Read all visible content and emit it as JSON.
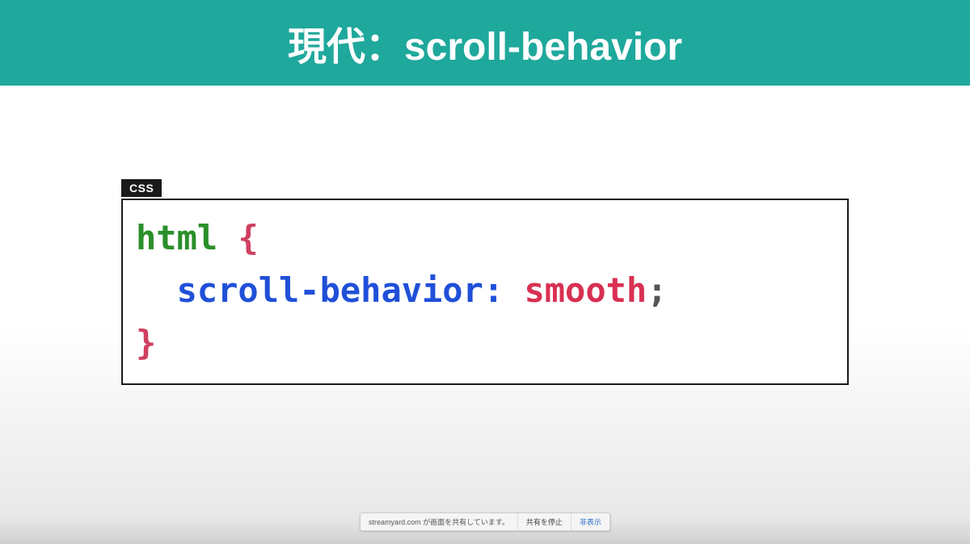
{
  "title": "現代：scroll-behavior",
  "code": {
    "label": "CSS",
    "selector": "html",
    "brace_open": "{",
    "property": "scroll-behavior",
    "colon": ":",
    "value": "smooth",
    "semicolon": ";",
    "brace_close": "}"
  },
  "share_bar": {
    "message": "streamyard.com が画面を共有しています。",
    "stop_button": "共有を停止",
    "hide_button": "非表示"
  }
}
